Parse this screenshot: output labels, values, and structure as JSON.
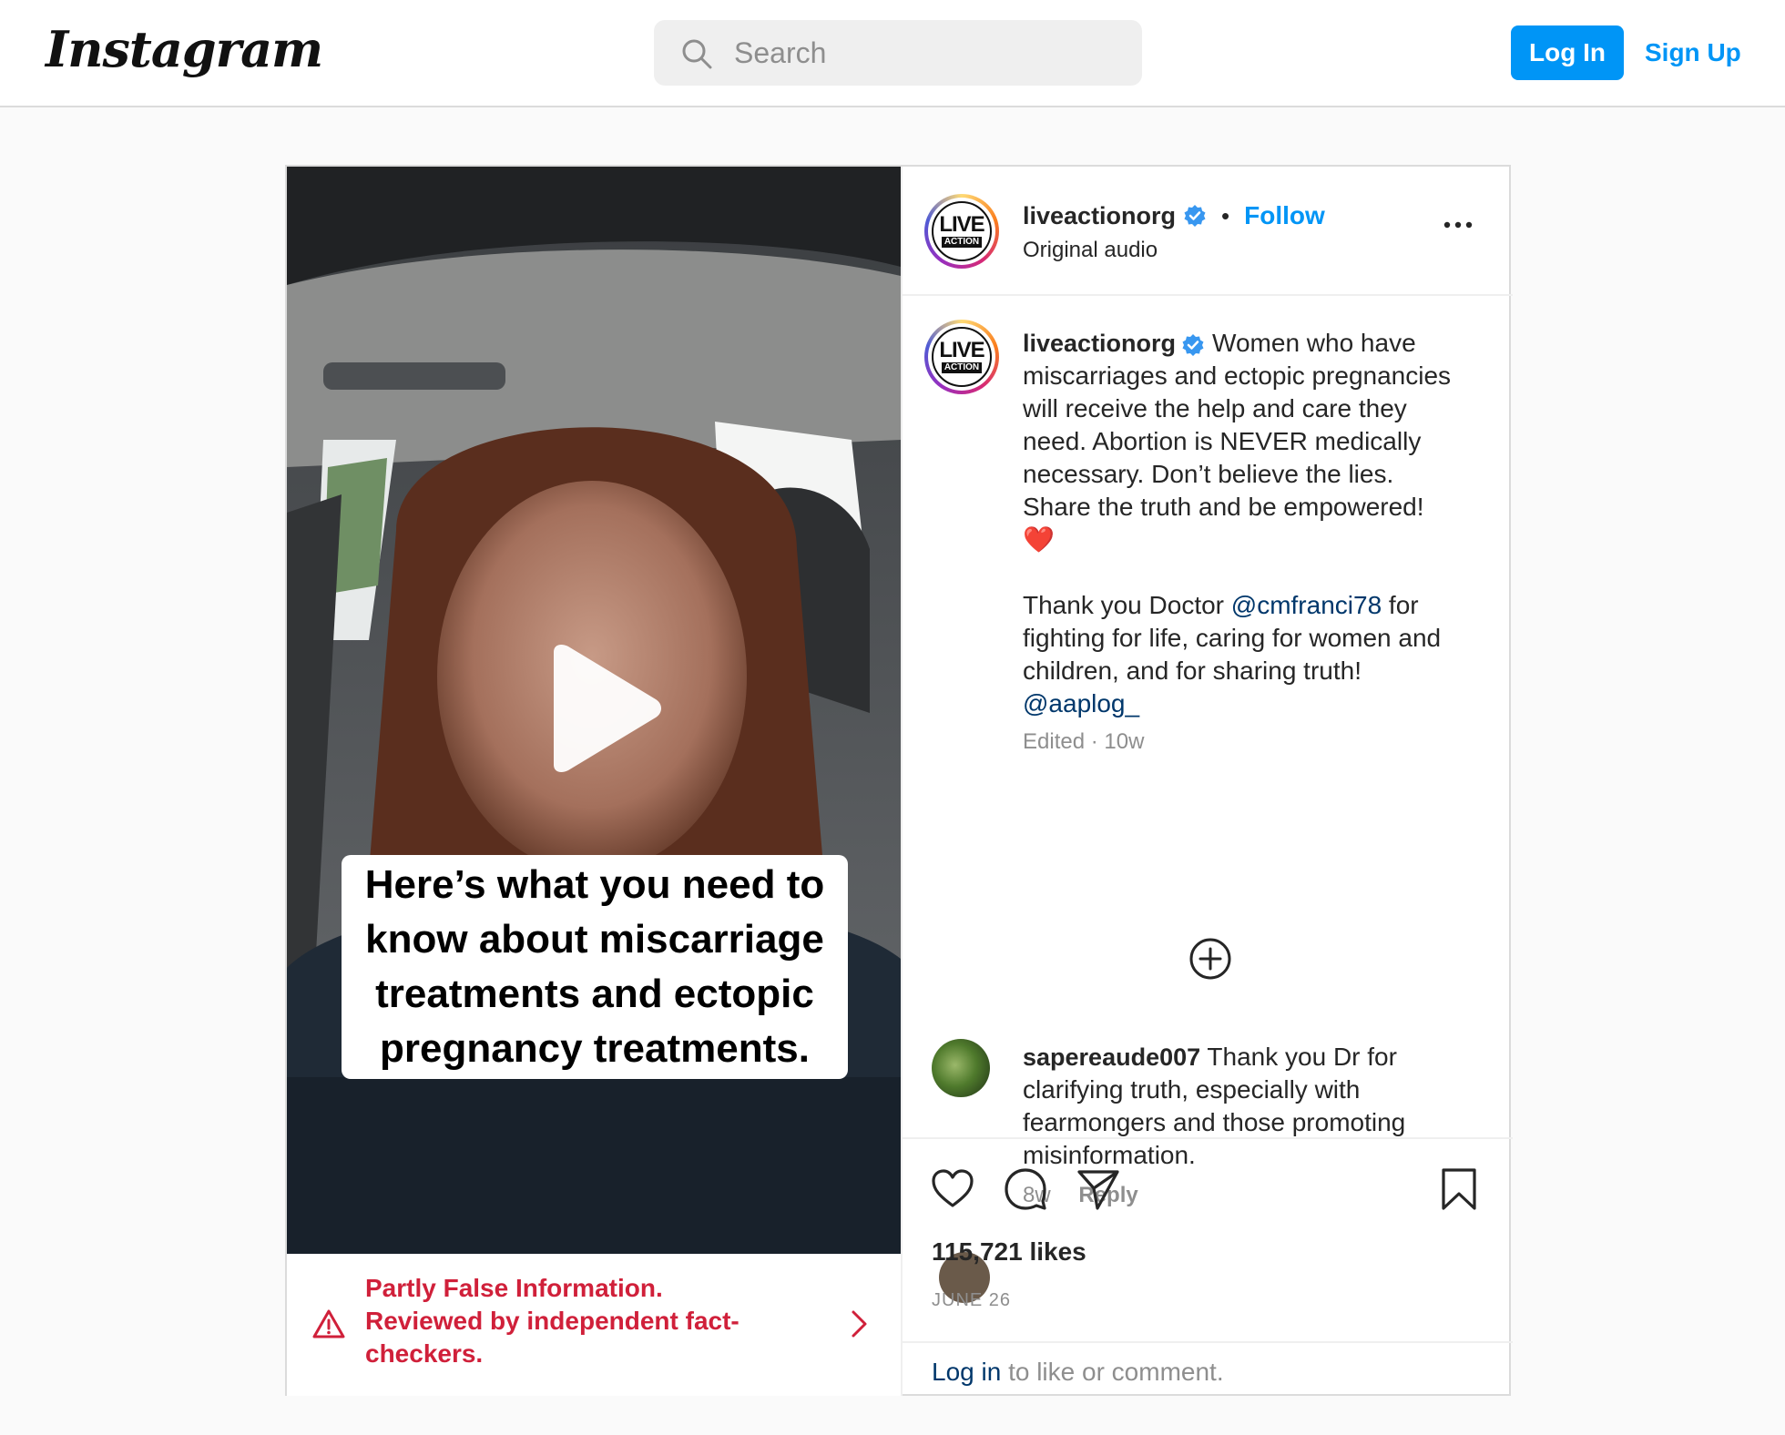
{
  "header": {
    "logo_text": "Instagram",
    "search_placeholder": "Search",
    "login_label": "Log In",
    "signup_label": "Sign Up"
  },
  "post": {
    "video_caption": "Here’s what you need to know about miscarriage treatments and ectopic pregnancy treatments.",
    "fact_check": {
      "line1": "Partly False Information.",
      "line2": "Reviewed by independent fact-checkers."
    },
    "author": {
      "username": "liveactionorg",
      "avatar_text_top": "LIVE",
      "avatar_text_bottom": "ACTION",
      "follow_label": "Follow",
      "separator": "•",
      "audio": "Original audio"
    },
    "caption": {
      "paragraph1": "Women who have miscarriages and ectopic pregnancies will receive the help and care they need. Abortion is NEVER medically necessary. Don’t believe the lies. Share the truth and be empowered! ❤️",
      "p2_before": "Thank you Doctor ",
      "mention1": "@cmfranci78",
      "p2_after": " for fighting for life, caring for women and children, and for sharing truth!",
      "mention2": "@aaplog_",
      "meta": "Edited · 10w"
    },
    "comments": [
      {
        "username": "sapereaude007",
        "text": "Thank you Dr for clarifying truth, especially with fearmongers and those promoting misinformation.",
        "age": "8w",
        "reply_label": "Reply"
      }
    ],
    "likes": "115,721 likes",
    "date": "JUNE 26",
    "login_prompt": {
      "link": "Log in",
      "rest": " to like or comment."
    }
  },
  "colors": {
    "accent": "#0095f6",
    "warning": "#d0203a",
    "mention": "#00376b"
  }
}
